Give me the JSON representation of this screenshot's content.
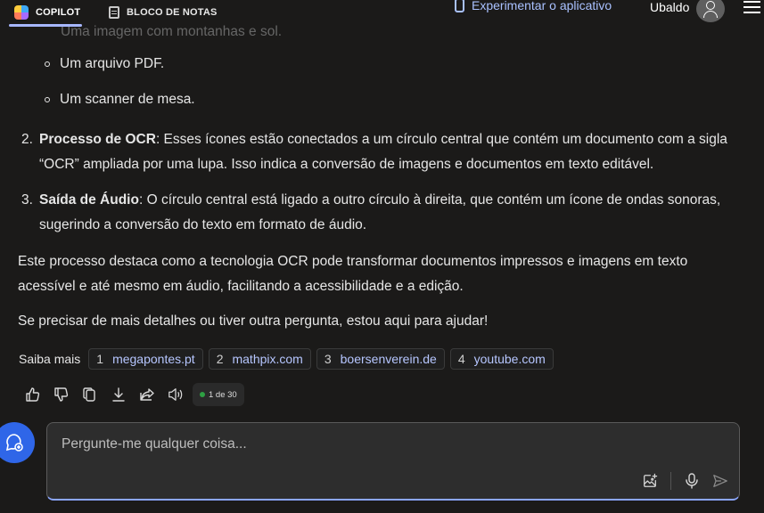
{
  "header": {
    "tabs": [
      {
        "label": "COPILOT",
        "active": true
      },
      {
        "label": "BLOCO DE NOTAS",
        "active": false
      }
    ],
    "try_app": "Experimentar o aplicativo",
    "user_name": "Ubaldo"
  },
  "content": {
    "faded_item": "Uma imagem com montanhas e sol.",
    "sub_items": [
      "Um arquivo PDF.",
      "Um scanner de mesa."
    ],
    "numbered": [
      {
        "num": "2.",
        "title": "Processo de OCR",
        "text": ": Esses ícones estão conectados a um círculo central que contém um documento com a sigla “OCR” ampliada por uma lupa. Isso indica a conversão de imagens e documentos em texto editável."
      },
      {
        "num": "3.",
        "title": "Saída de Áudio",
        "text": ": O círculo central está ligado a outro círculo à direita, que contém um ícone de ondas sonoras, sugerindo a conversão do texto em formato de áudio."
      }
    ],
    "paragraphs": [
      "Este processo destaca como a tecnologia OCR pode transformar documentos impressos e imagens em texto acessível e até mesmo em áudio, facilitando a acessibilidade e a edição.",
      "Se precisar de mais detalhes ou tiver outra pergunta, estou aqui para ajudar!"
    ]
  },
  "learn_more": {
    "label": "Saiba mais",
    "sources": [
      {
        "num": "1",
        "site": "megapontes.pt"
      },
      {
        "num": "2",
        "site": "mathpix.com"
      },
      {
        "num": "3",
        "site": "boersenverein.de"
      },
      {
        "num": "4",
        "site": "youtube.com"
      }
    ]
  },
  "actions": {
    "icons": [
      "thumbs-up-icon",
      "thumbs-down-icon",
      "copy-icon",
      "download-icon",
      "share-icon",
      "read-aloud-icon"
    ],
    "counter": "1 de 30"
  },
  "composer": {
    "placeholder": "Pergunte-me qualquer coisa..."
  },
  "colors": {
    "background": "#1b1a19",
    "accent": "#a9c1ff",
    "new_topic": "#2f66e8",
    "status_dot": "#2ea043"
  }
}
